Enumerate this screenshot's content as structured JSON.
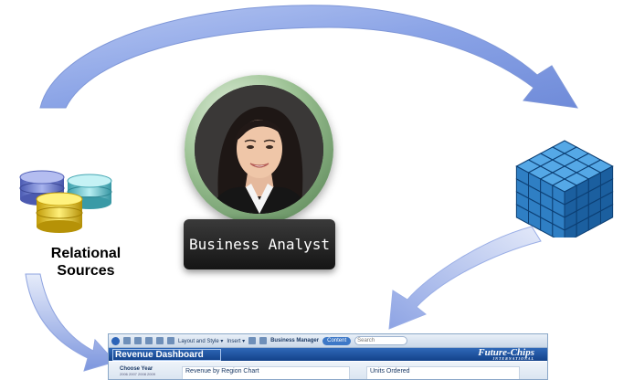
{
  "labels": {
    "relational_sources_line1": "Relational",
    "relational_sources_line2": "Sources",
    "business_analyst": "Business Analyst"
  },
  "icons": {
    "database": "database-stack-icon",
    "cube": "olap-cube-icon",
    "analyst": "analyst-portrait"
  },
  "colors": {
    "arrow": "#8ea8e6",
    "cube": "#2a7bc2",
    "db_blue": "#6b7fd1",
    "db_teal": "#63c4cf",
    "db_yellow": "#e6c21b"
  },
  "dashboard": {
    "toolbar": {
      "layout": "Layout and Style ▾",
      "insert": "Insert ▾",
      "business_manager": "Business Manager",
      "content": "Content",
      "search": "Search"
    },
    "title": "Revenue Dashboard",
    "brand": "Future-Chips",
    "brand_sub": "INTERNATIONAL",
    "choose_year": "Choose Year",
    "years": "2006 2007 2008 2009",
    "chart_panel": "Revenue by Region Chart",
    "units_panel": "Units Ordered"
  }
}
